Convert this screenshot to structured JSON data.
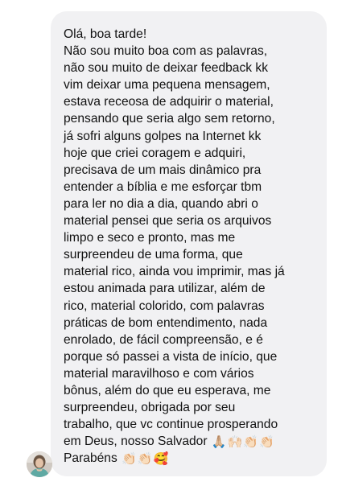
{
  "message": {
    "lines": [
      "Olá, boa tarde!",
      "Não sou muito boa com as palavras,",
      "não sou muito de deixar feedback kk",
      "vim deixar uma pequena mensagem,",
      "estava receosa de adquirir o material,",
      "pensando que seria algo sem retorno,",
      "já sofri alguns golpes na Internet kk",
      "hoje que criei coragem e adquiri,",
      "precisava de um mais dinâmico pra",
      "entender a bíblia e me esforçar tbm",
      "para ler no dia a dia, quando abri o",
      "material pensei que seria os arquivos",
      "limpo e seco e pronto, mas me",
      "surpreendeu de uma forma, que",
      "material rico, ainda vou imprimir, mas já",
      "estou animada para utilizar, além de",
      "rico, material colorido, com palavras",
      "práticas de bom entendimento, nada",
      "enrolado, de fácil compreensão, e é",
      "porque só passei a vista de início, que",
      "material maravilhoso e com vários",
      "bônus, além do que eu esperava, me",
      "surpreendeu, obrigada por seu",
      "trabalho, que vc continue prosperando"
    ],
    "line_25_text": "em Deus, nosso Salvador",
    "line_25_emojis": [
      "🙏🏼",
      "🙌🏻",
      "👏🏻",
      "👏🏻"
    ],
    "line_26_text": "Parabéns",
    "line_26_emojis": [
      "👏🏻",
      "👏🏻",
      "🥰"
    ]
  },
  "colors": {
    "bubble_background": "#f1f1f3",
    "text": "#111111"
  }
}
